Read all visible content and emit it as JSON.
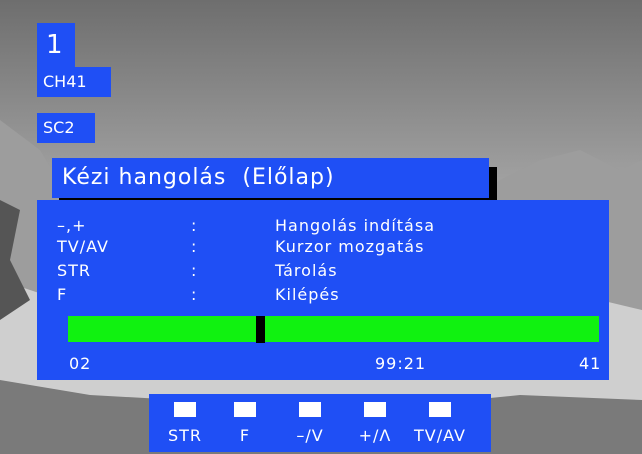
{
  "channel": {
    "number": "1",
    "name": "CH41",
    "source": "SC2"
  },
  "menu": {
    "title": "Kézi hangolás  (Előlap)",
    "rows": [
      {
        "key": "–,+",
        "sep": ":",
        "desc": "Hangolás indítása"
      },
      {
        "key": "TV/AV",
        "sep": ":",
        "desc": "Kurzor mozgatás"
      },
      {
        "key": "STR",
        "sep": ":",
        "desc": "Tárolás"
      },
      {
        "key": "F",
        "sep": ":",
        "desc": "Kilépés"
      }
    ],
    "tuning": {
      "band": "02",
      "frequency": "99:21",
      "channel": "41",
      "position": 0.36
    }
  },
  "keys": [
    {
      "label": "STR"
    },
    {
      "label": "F"
    },
    {
      "label": "–/V"
    },
    {
      "label": "+/Λ"
    },
    {
      "label": "TV/AV"
    }
  ],
  "colors": {
    "osd_blue": "#1f4ff5",
    "tuning_bar": "#10f210",
    "marker": "#000000",
    "text": "#ffffff"
  }
}
